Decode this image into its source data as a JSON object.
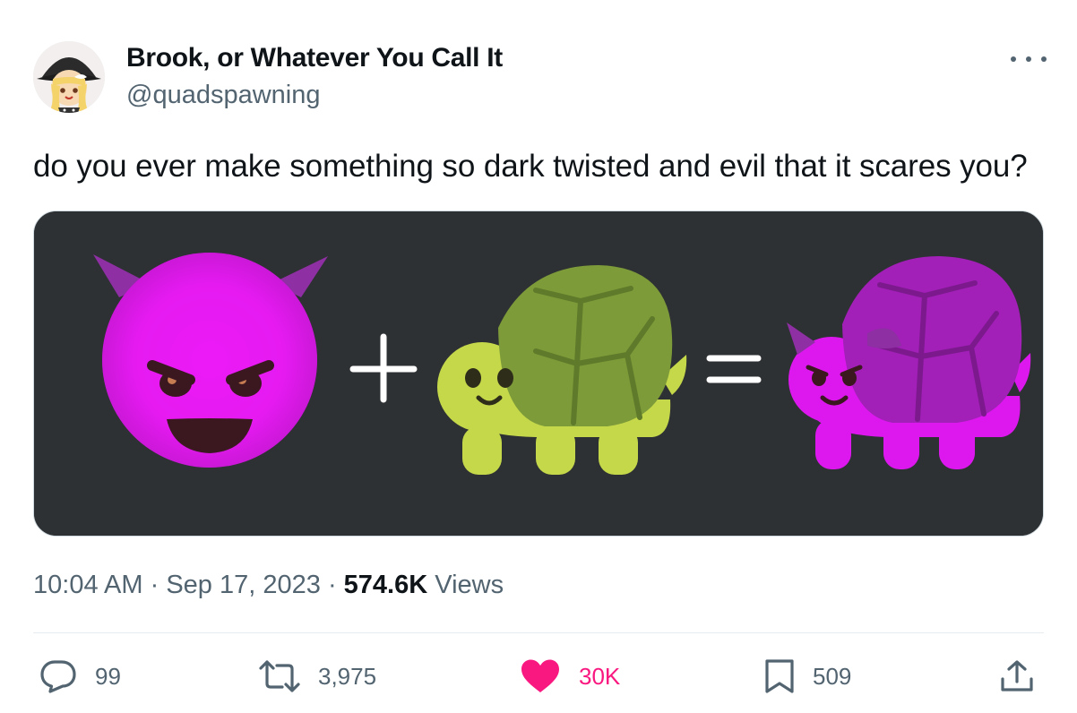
{
  "author": {
    "display_name": "Brook, or Whatever You Call It",
    "handle": "@quadspawning",
    "avatar_icon": "anime-witch-avatar"
  },
  "tweet": {
    "text": "do you ever make something so dark twisted and evil that it scares you?"
  },
  "media": {
    "description_icons": [
      "smiling-devil-emoji",
      "plus-sign",
      "turtle-emoji",
      "equals-sign",
      "devil-turtle-emoji"
    ],
    "background": "#2e3133"
  },
  "meta": {
    "time": "10:04 AM",
    "separator": "·",
    "date": "Sep 17, 2023",
    "views_count": "574.6K",
    "views_label": "Views"
  },
  "actions": {
    "replies": "99",
    "retweets": "3,975",
    "likes": "30K",
    "bookmarks": "509"
  },
  "colors": {
    "text_primary": "#0f1419",
    "text_secondary": "#536471",
    "like_active": "#f91880",
    "border": "#cfd9de"
  }
}
